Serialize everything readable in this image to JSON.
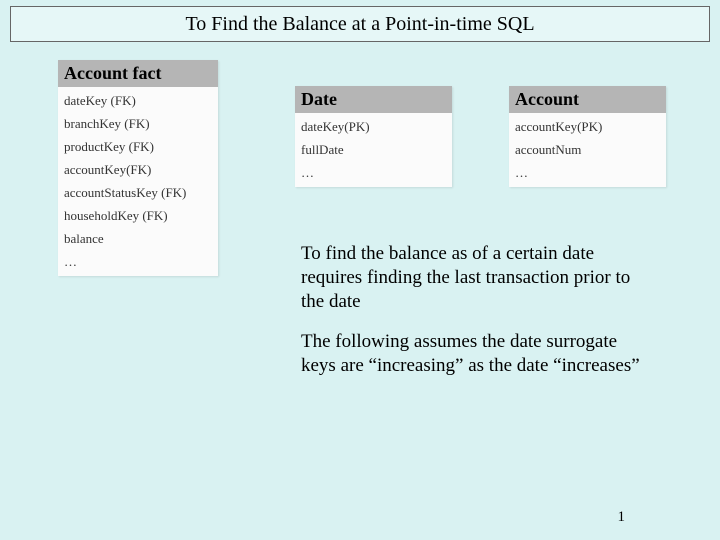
{
  "title": "To Find the Balance at a Point-in-time SQL",
  "tables": {
    "fact": {
      "header": "Account fact",
      "rows": [
        "dateKey (FK)",
        "branchKey (FK)",
        "productKey (FK)",
        "accountKey(FK)",
        "accountStatusKey (FK)",
        "householdKey (FK)",
        "balance",
        "…"
      ]
    },
    "date": {
      "header": "Date",
      "rows": [
        "dateKey(PK)",
        "fullDate",
        "…"
      ]
    },
    "account": {
      "header": "Account",
      "rows": [
        "accountKey(PK)",
        "accountNum",
        "…"
      ]
    }
  },
  "paragraphs": {
    "p1": "To find the balance as of a certain date requires finding the last transaction prior to the date",
    "p2": "The following assumes the date surrogate keys are “increasing” as the date “increases”"
  },
  "pageNumber": "1"
}
